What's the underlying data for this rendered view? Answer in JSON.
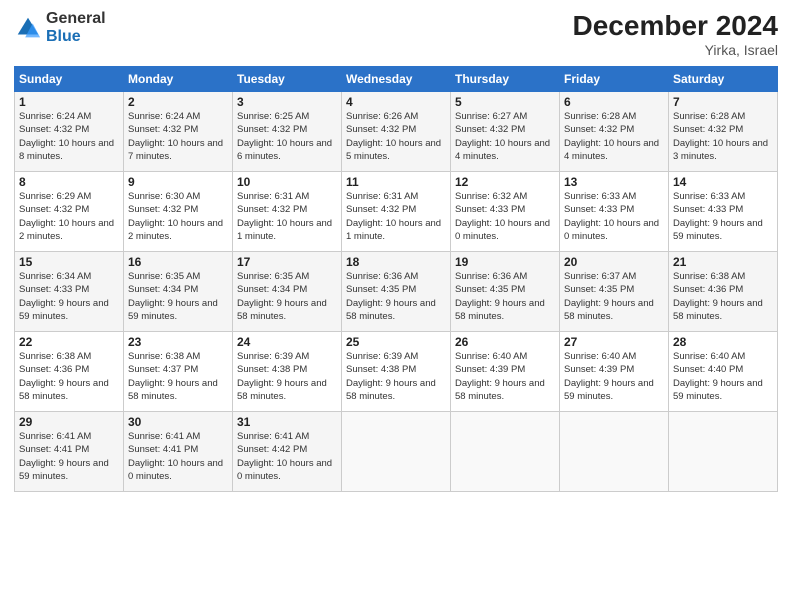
{
  "logo": {
    "line1": "General",
    "line2": "Blue"
  },
  "title": "December 2024",
  "subtitle": "Yirka, Israel",
  "days_header": [
    "Sunday",
    "Monday",
    "Tuesday",
    "Wednesday",
    "Thursday",
    "Friday",
    "Saturday"
  ],
  "weeks": [
    [
      {
        "num": "1",
        "sunrise": "6:24 AM",
        "sunset": "4:32 PM",
        "daylight": "10 hours and 8 minutes."
      },
      {
        "num": "2",
        "sunrise": "6:24 AM",
        "sunset": "4:32 PM",
        "daylight": "10 hours and 7 minutes."
      },
      {
        "num": "3",
        "sunrise": "6:25 AM",
        "sunset": "4:32 PM",
        "daylight": "10 hours and 6 minutes."
      },
      {
        "num": "4",
        "sunrise": "6:26 AM",
        "sunset": "4:32 PM",
        "daylight": "10 hours and 5 minutes."
      },
      {
        "num": "5",
        "sunrise": "6:27 AM",
        "sunset": "4:32 PM",
        "daylight": "10 hours and 4 minutes."
      },
      {
        "num": "6",
        "sunrise": "6:28 AM",
        "sunset": "4:32 PM",
        "daylight": "10 hours and 4 minutes."
      },
      {
        "num": "7",
        "sunrise": "6:28 AM",
        "sunset": "4:32 PM",
        "daylight": "10 hours and 3 minutes."
      }
    ],
    [
      {
        "num": "8",
        "sunrise": "6:29 AM",
        "sunset": "4:32 PM",
        "daylight": "10 hours and 2 minutes."
      },
      {
        "num": "9",
        "sunrise": "6:30 AM",
        "sunset": "4:32 PM",
        "daylight": "10 hours and 2 minutes."
      },
      {
        "num": "10",
        "sunrise": "6:31 AM",
        "sunset": "4:32 PM",
        "daylight": "10 hours and 1 minute."
      },
      {
        "num": "11",
        "sunrise": "6:31 AM",
        "sunset": "4:32 PM",
        "daylight": "10 hours and 1 minute."
      },
      {
        "num": "12",
        "sunrise": "6:32 AM",
        "sunset": "4:33 PM",
        "daylight": "10 hours and 0 minutes."
      },
      {
        "num": "13",
        "sunrise": "6:33 AM",
        "sunset": "4:33 PM",
        "daylight": "10 hours and 0 minutes."
      },
      {
        "num": "14",
        "sunrise": "6:33 AM",
        "sunset": "4:33 PM",
        "daylight": "9 hours and 59 minutes."
      }
    ],
    [
      {
        "num": "15",
        "sunrise": "6:34 AM",
        "sunset": "4:33 PM",
        "daylight": "9 hours and 59 minutes."
      },
      {
        "num": "16",
        "sunrise": "6:35 AM",
        "sunset": "4:34 PM",
        "daylight": "9 hours and 59 minutes."
      },
      {
        "num": "17",
        "sunrise": "6:35 AM",
        "sunset": "4:34 PM",
        "daylight": "9 hours and 58 minutes."
      },
      {
        "num": "18",
        "sunrise": "6:36 AM",
        "sunset": "4:35 PM",
        "daylight": "9 hours and 58 minutes."
      },
      {
        "num": "19",
        "sunrise": "6:36 AM",
        "sunset": "4:35 PM",
        "daylight": "9 hours and 58 minutes."
      },
      {
        "num": "20",
        "sunrise": "6:37 AM",
        "sunset": "4:35 PM",
        "daylight": "9 hours and 58 minutes."
      },
      {
        "num": "21",
        "sunrise": "6:38 AM",
        "sunset": "4:36 PM",
        "daylight": "9 hours and 58 minutes."
      }
    ],
    [
      {
        "num": "22",
        "sunrise": "6:38 AM",
        "sunset": "4:36 PM",
        "daylight": "9 hours and 58 minutes."
      },
      {
        "num": "23",
        "sunrise": "6:38 AM",
        "sunset": "4:37 PM",
        "daylight": "9 hours and 58 minutes."
      },
      {
        "num": "24",
        "sunrise": "6:39 AM",
        "sunset": "4:38 PM",
        "daylight": "9 hours and 58 minutes."
      },
      {
        "num": "25",
        "sunrise": "6:39 AM",
        "sunset": "4:38 PM",
        "daylight": "9 hours and 58 minutes."
      },
      {
        "num": "26",
        "sunrise": "6:40 AM",
        "sunset": "4:39 PM",
        "daylight": "9 hours and 58 minutes."
      },
      {
        "num": "27",
        "sunrise": "6:40 AM",
        "sunset": "4:39 PM",
        "daylight": "9 hours and 59 minutes."
      },
      {
        "num": "28",
        "sunrise": "6:40 AM",
        "sunset": "4:40 PM",
        "daylight": "9 hours and 59 minutes."
      }
    ],
    [
      {
        "num": "29",
        "sunrise": "6:41 AM",
        "sunset": "4:41 PM",
        "daylight": "9 hours and 59 minutes."
      },
      {
        "num": "30",
        "sunrise": "6:41 AM",
        "sunset": "4:41 PM",
        "daylight": "10 hours and 0 minutes."
      },
      {
        "num": "31",
        "sunrise": "6:41 AM",
        "sunset": "4:42 PM",
        "daylight": "10 hours and 0 minutes."
      },
      null,
      null,
      null,
      null
    ]
  ]
}
